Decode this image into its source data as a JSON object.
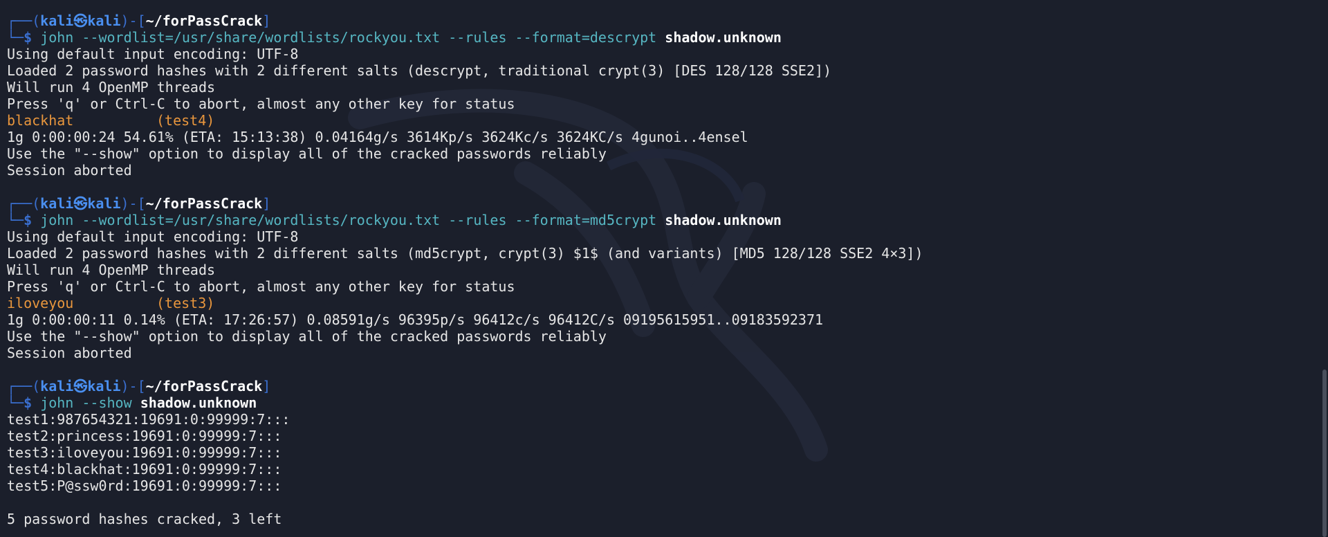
{
  "theme": {
    "background": "#1b1f2b",
    "prompt_frame": "#3a6fd0",
    "command": "#56b6c2",
    "cracked": "#e8963d"
  },
  "prompt": {
    "frame_top": "┌──(",
    "user": "kali㉿kali",
    "frame_mid": ")-[",
    "path": "~/forPassCrack",
    "frame_end": "]",
    "frame_bottom": "└─",
    "dollar": "$"
  },
  "blocks": [
    {
      "command": "john --wordlist=/usr/share/wordlists/rockyou.txt --rules --format=descrypt",
      "target": "shadow.unknown",
      "lines_before": [
        "Using default input encoding: UTF-8",
        "Loaded 2 password hashes with 2 different salts (descrypt, traditional crypt(3) [DES 128/128 SSE2])",
        "Will run 4 OpenMP threads",
        "Press 'q' or Ctrl-C to abort, almost any other key for status"
      ],
      "cracked_password": "blackhat",
      "cracked_user": "(test4)",
      "lines_after": [
        "1g 0:00:00:24 54.61% (ETA: 15:13:38) 0.04164g/s 3614Kp/s 3624Kc/s 3624KC/s 4gunoi..4ensel",
        "Use the \"--show\" option to display all of the cracked passwords reliably",
        "Session aborted"
      ]
    },
    {
      "command": "john --wordlist=/usr/share/wordlists/rockyou.txt --rules --format=md5crypt",
      "target": "shadow.unknown",
      "lines_before": [
        "Using default input encoding: UTF-8",
        "Loaded 2 password hashes with 2 different salts (md5crypt, crypt(3) $1$ (and variants) [MD5 128/128 SSE2 4×3])",
        "Will run 4 OpenMP threads",
        "Press 'q' or Ctrl-C to abort, almost any other key for status"
      ],
      "cracked_password": "iloveyou",
      "cracked_user": "(test3)",
      "lines_after": [
        "1g 0:00:00:11 0.14% (ETA: 17:26:57) 0.08591g/s 96395p/s 96412c/s 96412C/s 09195615951..09183592371",
        "Use the \"--show\" option to display all of the cracked passwords reliably",
        "Session aborted"
      ]
    }
  ],
  "show_block": {
    "command": "john --show",
    "target": "shadow.unknown",
    "results": [
      "test1:987654321:19691:0:99999:7:::",
      "test2:princess:19691:0:99999:7:::",
      "test3:iloveyou:19691:0:99999:7:::",
      "test4:blackhat:19691:0:99999:7:::",
      "test5:P@ssw0rd:19691:0:99999:7:::"
    ],
    "summary": "5 password hashes cracked, 3 left"
  }
}
